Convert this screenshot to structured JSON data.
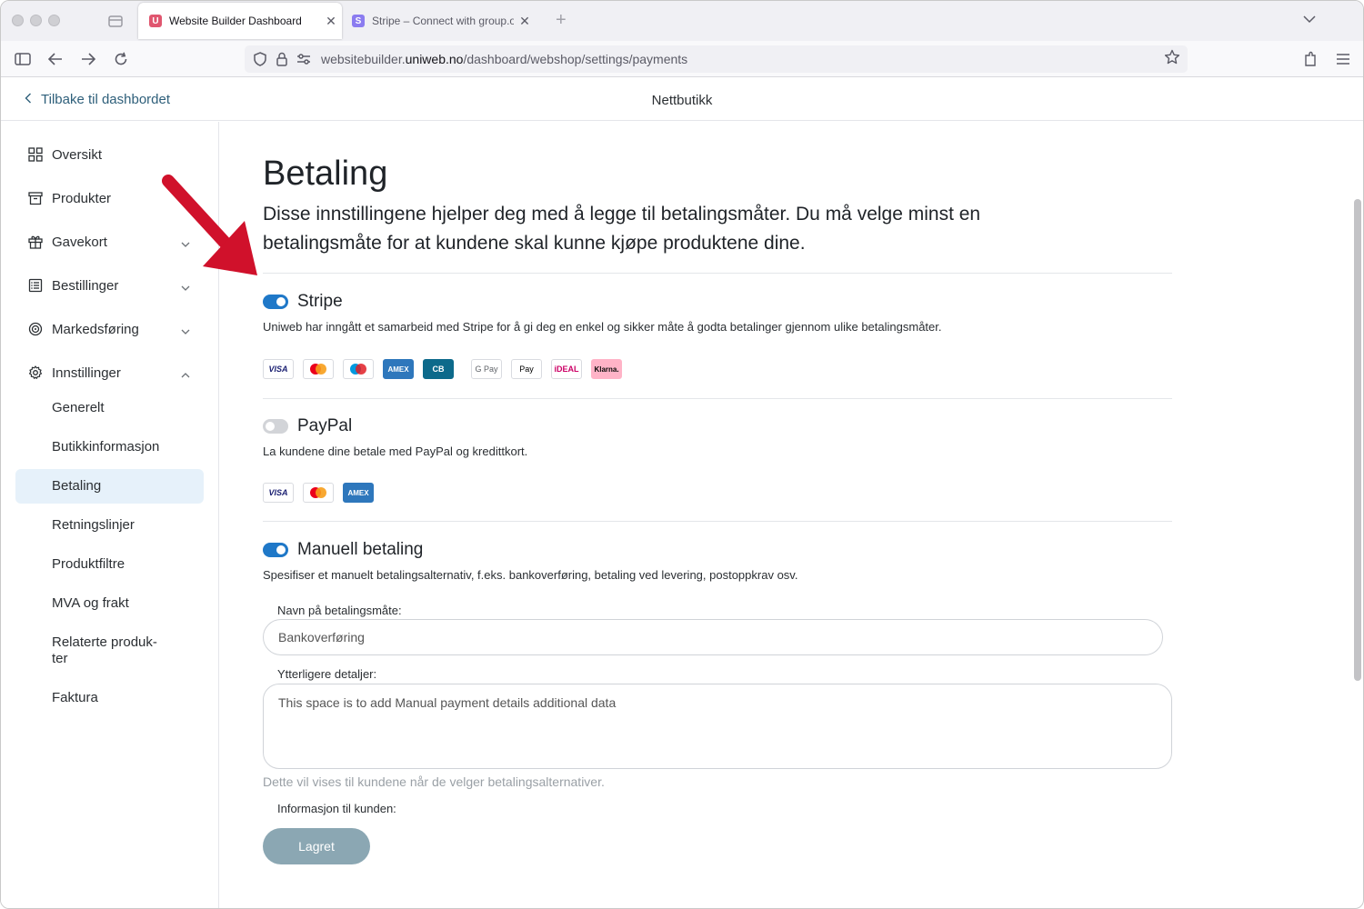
{
  "browser": {
    "tabs": [
      {
        "title": "Website Builder Dashboard",
        "favicon": "U",
        "favicon_color": "#e0566f",
        "active": true
      },
      {
        "title": "Stripe – Connect with group.one",
        "favicon": "S",
        "favicon_color": "#8b7cf0",
        "active": false
      }
    ],
    "url": {
      "prefix": "websitebuilder.",
      "domain": "uniweb.no",
      "path": "/dashboard/webshop/settings/payments"
    }
  },
  "header": {
    "back_label": "Tilbake til dashbordet",
    "title": "Nettbutikk"
  },
  "sidebar": {
    "items": [
      {
        "label": "Oversikt",
        "icon": "grid-icon",
        "expandable": false
      },
      {
        "label": "Produkter",
        "icon": "archive-box-icon",
        "expandable": false
      },
      {
        "label": "Gavekort",
        "icon": "gift-icon",
        "expandable": true,
        "expanded": false
      },
      {
        "label": "Bestillinger",
        "icon": "order-list-icon",
        "expandable": true,
        "expanded": false
      },
      {
        "label": "Markedsføring",
        "icon": "target-icon",
        "expandable": true,
        "expanded": false
      },
      {
        "label": "Innstillinger",
        "icon": "gear-icon",
        "expandable": true,
        "expanded": true
      }
    ],
    "sub_items": [
      {
        "label": "Generelt"
      },
      {
        "label": "Butikkinformasjon"
      },
      {
        "label": "Betaling",
        "active": true
      },
      {
        "label": "Retningslinjer"
      },
      {
        "label": "Produktfiltre"
      },
      {
        "label": "MVA og frakt"
      },
      {
        "label": "Relaterte produk-",
        "label2": "ter"
      },
      {
        "label": "Faktura"
      }
    ]
  },
  "main": {
    "title": "Betaling",
    "description": "Disse innstillingene hjelper deg med å legge til betalingsmåter. Du må velge minst en betalingsmåte for at kundene skal kunne kjøpe produktene dine.",
    "stripe": {
      "title": "Stripe",
      "enabled": true,
      "description": "Uniweb har inngått et samarbeid med Stripe for å gi deg en enkel og sikker måte å godta betalinger gjennom ulike betalingsmåter.",
      "cards": [
        "VISA",
        "Mastercard",
        "Maestro",
        "AMEX",
        "CB",
        "G Pay",
        "Apple Pay",
        "iDEAL",
        "Klarna."
      ]
    },
    "paypal": {
      "title": "PayPal",
      "enabled": false,
      "description": "La kundene dine betale med PayPal og kredittkort.",
      "cards": [
        "VISA",
        "Mastercard",
        "AMEX"
      ]
    },
    "manual": {
      "title": "Manuell betaling",
      "enabled": true,
      "description": "Spesifiser et manuelt betalingsalternativ, f.eks. bankoverføring, betaling ved levering, postoppkrav osv.",
      "name_label": "Navn på betalingsmåte:",
      "name_value": "Bankoverføring",
      "details_label": "Ytterligere detaljer:",
      "details_value": "This space is to add Manual payment details additional data",
      "hint": "Dette vil vises til kundene når de velger betalingsalternativer.",
      "info_label": "Informasjon til kunden:",
      "save_label": "Lagret"
    }
  },
  "colors": {
    "accent": "#1f78c8",
    "active_nav_bg": "#e6f1fa",
    "save_button": "#8ba7b3",
    "annotation_arrow": "#d0112b"
  }
}
